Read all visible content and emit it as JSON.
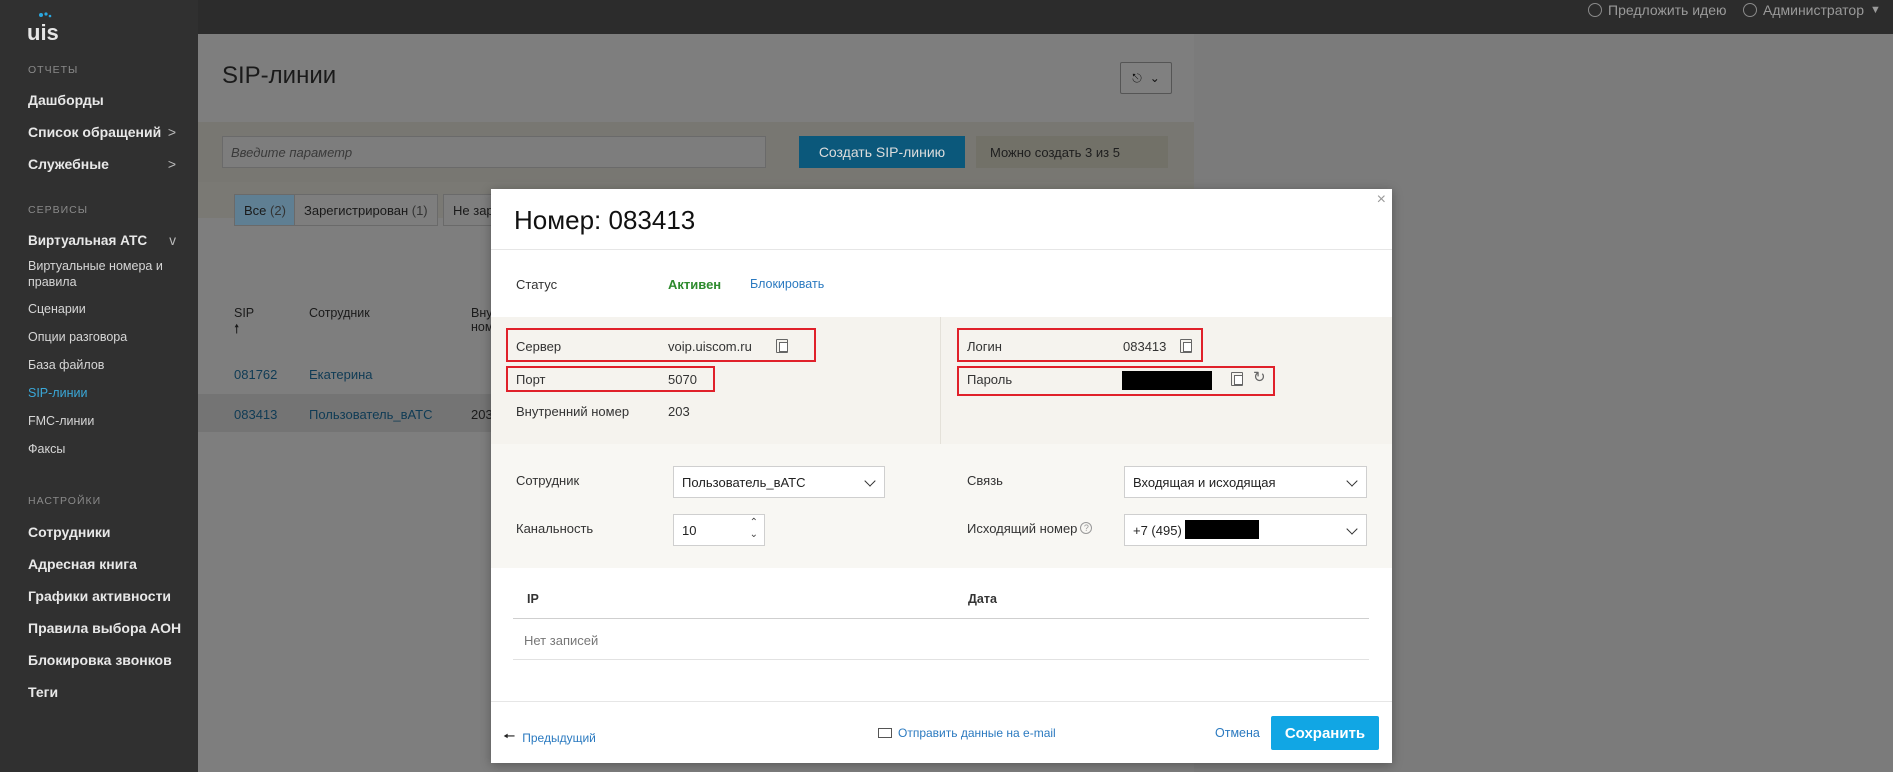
{
  "topbar": {
    "suggest": "Предложить идею",
    "admin": "Администратор"
  },
  "sidebar": {
    "logo": "uis",
    "sections": {
      "reports": "ОТЧЕТЫ",
      "services": "СЕРВИСЫ",
      "settings": "НАСТРОЙКИ"
    },
    "reports_items": [
      "Дашборды",
      "Список обращений",
      "Служебные"
    ],
    "vats": "Виртуальная АТС",
    "vats_items": [
      "Виртуальные номера и правила",
      "Сценарии",
      "Опции разговора",
      "База файлов",
      "SIP-линии",
      "FMC-линии",
      "Факсы"
    ],
    "settings_items": [
      "Сотрудники",
      "Адресная книга",
      "Графики активности",
      "Правила выбора АОН",
      "Блокировка звонков",
      "Теги"
    ]
  },
  "page": {
    "title": "SIP-линии",
    "search_placeholder": "Введите параметр",
    "create_button": "Создать SIP-линию",
    "can_create": "Можно создать 3 из 5",
    "filters": [
      {
        "label": "Все",
        "count": "(2)"
      },
      {
        "label": "Зарегистрирован",
        "count": "(1)"
      },
      {
        "label": "Не зар",
        "count": ""
      }
    ],
    "columns": [
      "SIP",
      "Сотрудник",
      "Вну",
      "ном"
    ],
    "rows": [
      {
        "sip": "081762",
        "employee": "Екатерина",
        "internal": ""
      },
      {
        "sip": "083413",
        "employee": "Пользователь_вАТС",
        "internal": "203"
      }
    ]
  },
  "modal": {
    "title": "Номер: 083413",
    "status_label": "Статус",
    "status_value": "Активен",
    "block_link": "Блокировать",
    "server_label": "Сервер",
    "server_value": "voip.uiscom.ru",
    "port_label": "Порт",
    "port_value": "5070",
    "internal_label": "Внутренний номер",
    "internal_value": "203",
    "login_label": "Логин",
    "login_value": "083413",
    "password_label": "Пароль",
    "employee_label": "Сотрудник",
    "employee_value": "Пользователь_вАТС",
    "channels_label": "Канальность",
    "channels_value": "10",
    "link_label": "Связь",
    "link_value": "Входящая и исходящая",
    "outgoing_label": "Исходящий номер",
    "outgoing_value": "+7 (495)",
    "table_ip": "IP",
    "table_date": "Дата",
    "no_records": "Нет записей",
    "prev": "Предыдущий",
    "send_email": "Отправить данные на e-mail",
    "cancel": "Отмена",
    "save": "Сохранить"
  },
  "colors": {
    "accent": "#11a6e4",
    "highlight": "#e0202a",
    "status_active": "#2e8b2e"
  }
}
